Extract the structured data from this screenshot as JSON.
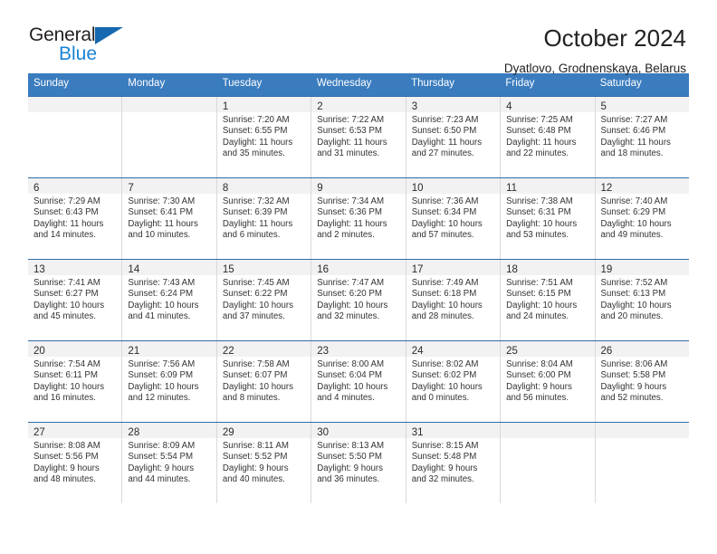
{
  "brand": {
    "name_top": "General",
    "name_bottom": "Blue",
    "color_dark": "#231f20",
    "color_blue": "#1a84d6",
    "triangle_color": "#1669b0"
  },
  "header": {
    "title": "October 2024",
    "subtitle": "Dyatlovo, Grodnenskaya, Belarus"
  },
  "theme": {
    "header_bar_color": "#3a7cbe",
    "row_border_color": "#2f6ca8",
    "day_strip_color": "#f2f2f2",
    "cell_divider_color": "#d9d9d9"
  },
  "weekdays": [
    "Sunday",
    "Monday",
    "Tuesday",
    "Wednesday",
    "Thursday",
    "Friday",
    "Saturday"
  ],
  "labels": {
    "sunrise_prefix": "Sunrise:",
    "sunset_prefix": "Sunset:",
    "daylight_prefix": "Daylight:"
  },
  "weeks": [
    [
      {
        "day": "",
        "empty": true
      },
      {
        "day": "",
        "empty": true
      },
      {
        "day": "1",
        "sunrise": "Sunrise: 7:20 AM",
        "sunset": "Sunset: 6:55 PM",
        "daylight_line1": "Daylight: 11 hours",
        "daylight_line2": "and 35 minutes."
      },
      {
        "day": "2",
        "sunrise": "Sunrise: 7:22 AM",
        "sunset": "Sunset: 6:53 PM",
        "daylight_line1": "Daylight: 11 hours",
        "daylight_line2": "and 31 minutes."
      },
      {
        "day": "3",
        "sunrise": "Sunrise: 7:23 AM",
        "sunset": "Sunset: 6:50 PM",
        "daylight_line1": "Daylight: 11 hours",
        "daylight_line2": "and 27 minutes."
      },
      {
        "day": "4",
        "sunrise": "Sunrise: 7:25 AM",
        "sunset": "Sunset: 6:48 PM",
        "daylight_line1": "Daylight: 11 hours",
        "daylight_line2": "and 22 minutes."
      },
      {
        "day": "5",
        "sunrise": "Sunrise: 7:27 AM",
        "sunset": "Sunset: 6:46 PM",
        "daylight_line1": "Daylight: 11 hours",
        "daylight_line2": "and 18 minutes."
      }
    ],
    [
      {
        "day": "6",
        "sunrise": "Sunrise: 7:29 AM",
        "sunset": "Sunset: 6:43 PM",
        "daylight_line1": "Daylight: 11 hours",
        "daylight_line2": "and 14 minutes."
      },
      {
        "day": "7",
        "sunrise": "Sunrise: 7:30 AM",
        "sunset": "Sunset: 6:41 PM",
        "daylight_line1": "Daylight: 11 hours",
        "daylight_line2": "and 10 minutes."
      },
      {
        "day": "8",
        "sunrise": "Sunrise: 7:32 AM",
        "sunset": "Sunset: 6:39 PM",
        "daylight_line1": "Daylight: 11 hours",
        "daylight_line2": "and 6 minutes."
      },
      {
        "day": "9",
        "sunrise": "Sunrise: 7:34 AM",
        "sunset": "Sunset: 6:36 PM",
        "daylight_line1": "Daylight: 11 hours",
        "daylight_line2": "and 2 minutes."
      },
      {
        "day": "10",
        "sunrise": "Sunrise: 7:36 AM",
        "sunset": "Sunset: 6:34 PM",
        "daylight_line1": "Daylight: 10 hours",
        "daylight_line2": "and 57 minutes."
      },
      {
        "day": "11",
        "sunrise": "Sunrise: 7:38 AM",
        "sunset": "Sunset: 6:31 PM",
        "daylight_line1": "Daylight: 10 hours",
        "daylight_line2": "and 53 minutes."
      },
      {
        "day": "12",
        "sunrise": "Sunrise: 7:40 AM",
        "sunset": "Sunset: 6:29 PM",
        "daylight_line1": "Daylight: 10 hours",
        "daylight_line2": "and 49 minutes."
      }
    ],
    [
      {
        "day": "13",
        "sunrise": "Sunrise: 7:41 AM",
        "sunset": "Sunset: 6:27 PM",
        "daylight_line1": "Daylight: 10 hours",
        "daylight_line2": "and 45 minutes."
      },
      {
        "day": "14",
        "sunrise": "Sunrise: 7:43 AM",
        "sunset": "Sunset: 6:24 PM",
        "daylight_line1": "Daylight: 10 hours",
        "daylight_line2": "and 41 minutes."
      },
      {
        "day": "15",
        "sunrise": "Sunrise: 7:45 AM",
        "sunset": "Sunset: 6:22 PM",
        "daylight_line1": "Daylight: 10 hours",
        "daylight_line2": "and 37 minutes."
      },
      {
        "day": "16",
        "sunrise": "Sunrise: 7:47 AM",
        "sunset": "Sunset: 6:20 PM",
        "daylight_line1": "Daylight: 10 hours",
        "daylight_line2": "and 32 minutes."
      },
      {
        "day": "17",
        "sunrise": "Sunrise: 7:49 AM",
        "sunset": "Sunset: 6:18 PM",
        "daylight_line1": "Daylight: 10 hours",
        "daylight_line2": "and 28 minutes."
      },
      {
        "day": "18",
        "sunrise": "Sunrise: 7:51 AM",
        "sunset": "Sunset: 6:15 PM",
        "daylight_line1": "Daylight: 10 hours",
        "daylight_line2": "and 24 minutes."
      },
      {
        "day": "19",
        "sunrise": "Sunrise: 7:52 AM",
        "sunset": "Sunset: 6:13 PM",
        "daylight_line1": "Daylight: 10 hours",
        "daylight_line2": "and 20 minutes."
      }
    ],
    [
      {
        "day": "20",
        "sunrise": "Sunrise: 7:54 AM",
        "sunset": "Sunset: 6:11 PM",
        "daylight_line1": "Daylight: 10 hours",
        "daylight_line2": "and 16 minutes."
      },
      {
        "day": "21",
        "sunrise": "Sunrise: 7:56 AM",
        "sunset": "Sunset: 6:09 PM",
        "daylight_line1": "Daylight: 10 hours",
        "daylight_line2": "and 12 minutes."
      },
      {
        "day": "22",
        "sunrise": "Sunrise: 7:58 AM",
        "sunset": "Sunset: 6:07 PM",
        "daylight_line1": "Daylight: 10 hours",
        "daylight_line2": "and 8 minutes."
      },
      {
        "day": "23",
        "sunrise": "Sunrise: 8:00 AM",
        "sunset": "Sunset: 6:04 PM",
        "daylight_line1": "Daylight: 10 hours",
        "daylight_line2": "and 4 minutes."
      },
      {
        "day": "24",
        "sunrise": "Sunrise: 8:02 AM",
        "sunset": "Sunset: 6:02 PM",
        "daylight_line1": "Daylight: 10 hours",
        "daylight_line2": "and 0 minutes."
      },
      {
        "day": "25",
        "sunrise": "Sunrise: 8:04 AM",
        "sunset": "Sunset: 6:00 PM",
        "daylight_line1": "Daylight: 9 hours",
        "daylight_line2": "and 56 minutes."
      },
      {
        "day": "26",
        "sunrise": "Sunrise: 8:06 AM",
        "sunset": "Sunset: 5:58 PM",
        "daylight_line1": "Daylight: 9 hours",
        "daylight_line2": "and 52 minutes."
      }
    ],
    [
      {
        "day": "27",
        "sunrise": "Sunrise: 8:08 AM",
        "sunset": "Sunset: 5:56 PM",
        "daylight_line1": "Daylight: 9 hours",
        "daylight_line2": "and 48 minutes."
      },
      {
        "day": "28",
        "sunrise": "Sunrise: 8:09 AM",
        "sunset": "Sunset: 5:54 PM",
        "daylight_line1": "Daylight: 9 hours",
        "daylight_line2": "and 44 minutes."
      },
      {
        "day": "29",
        "sunrise": "Sunrise: 8:11 AM",
        "sunset": "Sunset: 5:52 PM",
        "daylight_line1": "Daylight: 9 hours",
        "daylight_line2": "and 40 minutes."
      },
      {
        "day": "30",
        "sunrise": "Sunrise: 8:13 AM",
        "sunset": "Sunset: 5:50 PM",
        "daylight_line1": "Daylight: 9 hours",
        "daylight_line2": "and 36 minutes."
      },
      {
        "day": "31",
        "sunrise": "Sunrise: 8:15 AM",
        "sunset": "Sunset: 5:48 PM",
        "daylight_line1": "Daylight: 9 hours",
        "daylight_line2": "and 32 minutes."
      },
      {
        "day": "",
        "empty": true
      },
      {
        "day": "",
        "empty": true
      }
    ]
  ]
}
